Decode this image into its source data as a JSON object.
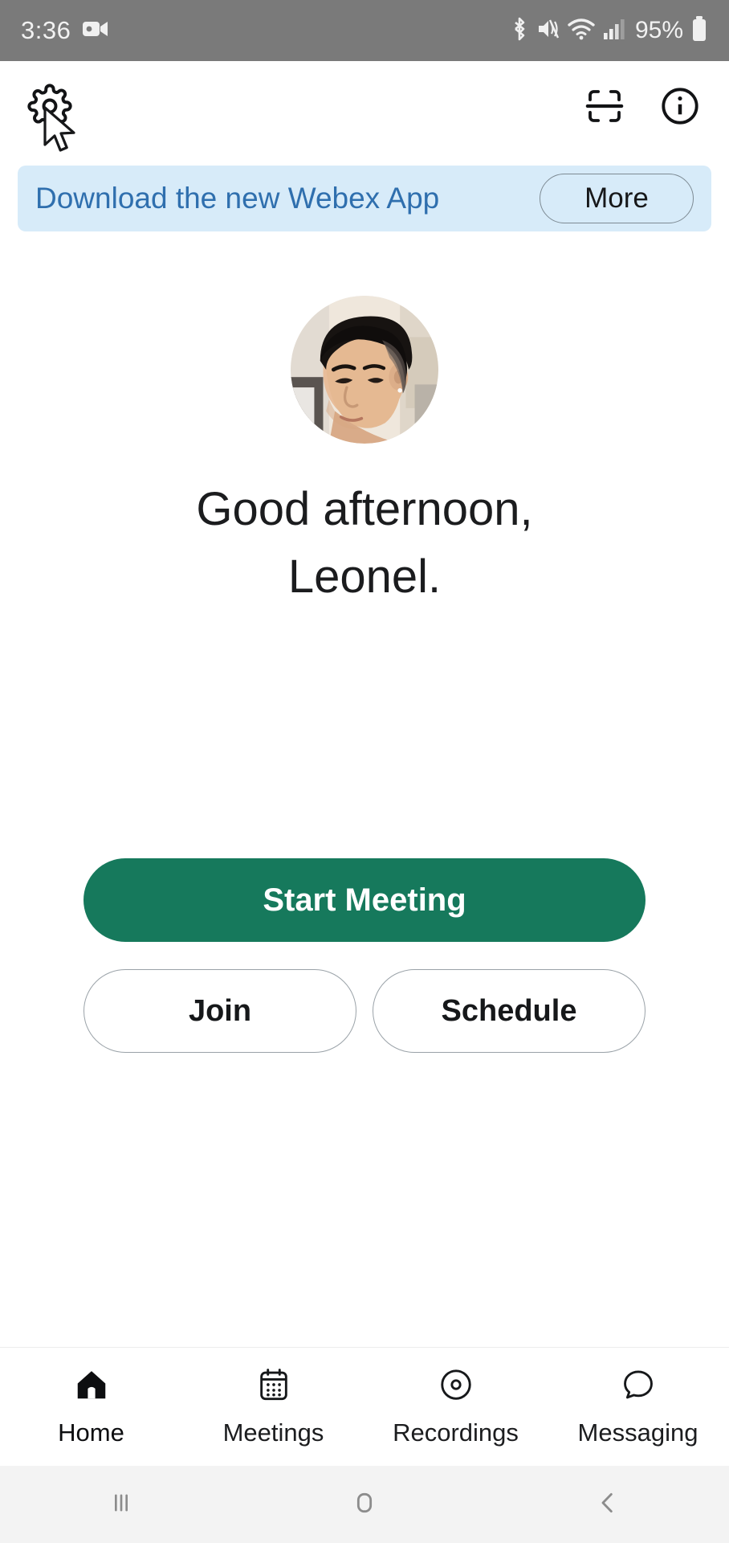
{
  "status_bar": {
    "time": "3:36",
    "battery_percent": "95%",
    "icons": [
      "video-camera-icon",
      "bluetooth-icon",
      "mute-vibrate-icon",
      "wifi-icon",
      "cellular-signal-icon",
      "battery-icon"
    ],
    "background_color": "#7a7a7a"
  },
  "app_bar": {
    "settings_icon": "gear-icon",
    "scan_icon": "scan-code-icon",
    "info_icon": "info-circle-icon",
    "cursor": "mouse-pointer"
  },
  "banner": {
    "text": "Download the new Webex App",
    "button_label": "More",
    "background_color": "#d7ebf9",
    "text_color": "#2f6fae"
  },
  "profile": {
    "avatar": "user-avatar-photo",
    "greeting_line1": "Good afternoon,",
    "greeting_line2": "Leonel."
  },
  "actions": {
    "primary_label": "Start Meeting",
    "primary_color": "#16795c",
    "join_label": "Join",
    "schedule_label": "Schedule"
  },
  "tab_bar": {
    "active": "Home",
    "items": [
      {
        "label": "Home",
        "icon": "home-icon"
      },
      {
        "label": "Meetings",
        "icon": "calendar-icon"
      },
      {
        "label": "Recordings",
        "icon": "disc-record-icon"
      },
      {
        "label": "Messaging",
        "icon": "chat-bubble-icon"
      }
    ]
  },
  "android_nav": {
    "recents": "recents-icon",
    "home": "home-square-icon",
    "back": "back-chevron-icon"
  }
}
